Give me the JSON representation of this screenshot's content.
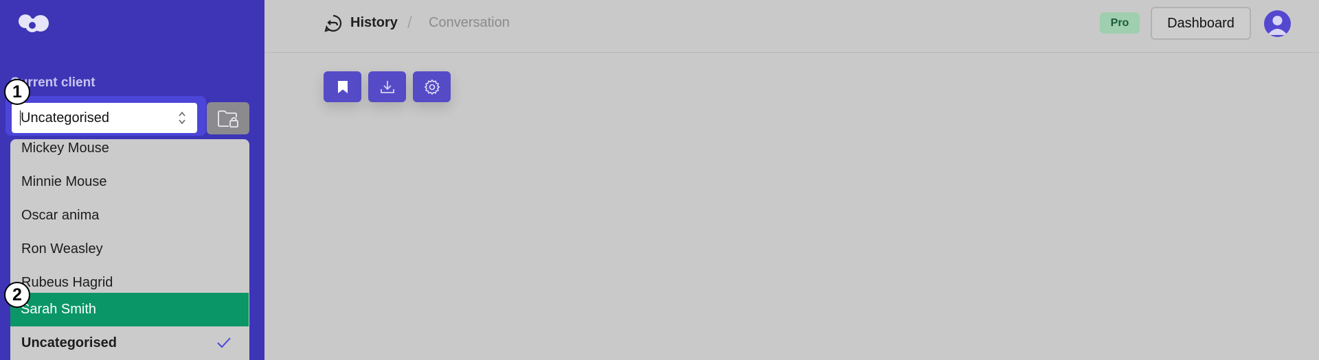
{
  "sidebar": {
    "current_client_label": "Current client",
    "select_value": "Uncategorised",
    "dropdown_items": [
      {
        "label": "Mickey Mouse"
      },
      {
        "label": "Minnie Mouse"
      },
      {
        "label": "Oscar anima"
      },
      {
        "label": "Ron Weasley"
      },
      {
        "label": "Rubeus Hagrid"
      },
      {
        "label": "Sarah Smith"
      },
      {
        "label": "Uncategorised"
      }
    ],
    "highlighted_item": "Sarah Smith",
    "selected_item": "Uncategorised"
  },
  "markers": [
    "1",
    "2"
  ],
  "header": {
    "breadcrumb_history": "History",
    "breadcrumb_separator": "/",
    "breadcrumb_current": "Conversation",
    "badge": "Pro",
    "dashboard_button": "Dashboard"
  },
  "toolbar": {
    "buttons": [
      "bookmark-icon",
      "download-icon",
      "gear-icon"
    ]
  },
  "colors": {
    "sidebar_bg": "#3d35b6",
    "accent": "#554bc7",
    "highlight_green": "#0b9668",
    "page_bg": "#c9c9c9",
    "pro_badge": "#9fcfae"
  }
}
